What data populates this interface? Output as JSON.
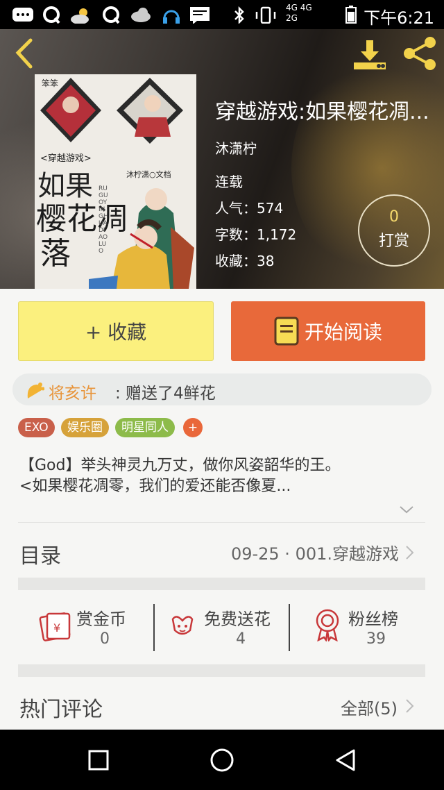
{
  "status_bar": {
    "time": "下午6:21",
    "network": "4G 4G",
    "network_sub": "2G"
  },
  "header": {
    "book_title": "穿越游戏:如果樱花凋...",
    "author": "沐潇柠",
    "status": "连载",
    "popularity_label": "人气：",
    "popularity": "574",
    "wordcount_label": "字数：",
    "wordcount": "1,172",
    "favorites_label": "收藏：",
    "favorites": "38",
    "tip_count": "0",
    "tip_label": "打赏"
  },
  "cover": {
    "corner_mark": "笨笨",
    "subtitle": "<穿越游戏>",
    "line1": "如果",
    "line2": "樱花凋",
    "line3": "落",
    "pinyin": "RUGUOYINGHUA DIAOLUO",
    "credit": "沐柠潇○文档"
  },
  "actions": {
    "favorite_label": "+ 收藏",
    "read_label": "开始阅读"
  },
  "gift": {
    "user": "将亥许",
    "text": ": 赠送了4鲜花"
  },
  "tags": [
    {
      "label": "EXO",
      "color": "#c9604a"
    },
    {
      "label": "娱乐圈",
      "color": "#d6a23a"
    },
    {
      "label": "明星同人",
      "color": "#8dbb4a"
    },
    {
      "label": "+",
      "color": "#e9673a"
    }
  ],
  "description": {
    "line1": "【God】举头神灵九万丈，做你风姿韶华的王。",
    "line2": "<如果樱花凋零，我们的爱还能否像夏..."
  },
  "toc": {
    "label": "目录",
    "latest": "09-25 · 001.穿越游戏"
  },
  "stats": [
    {
      "label": "赏金币",
      "value": "0"
    },
    {
      "label": "免费送花",
      "value": "4"
    },
    {
      "label": "粉丝榜",
      "value": "39"
    }
  ],
  "comments": {
    "label": "热门评论",
    "all": "全部(5)"
  },
  "colors": {
    "accent_orange": "#e8693a",
    "accent_yellow": "#fbf07e",
    "icon_red": "#c8383a"
  }
}
